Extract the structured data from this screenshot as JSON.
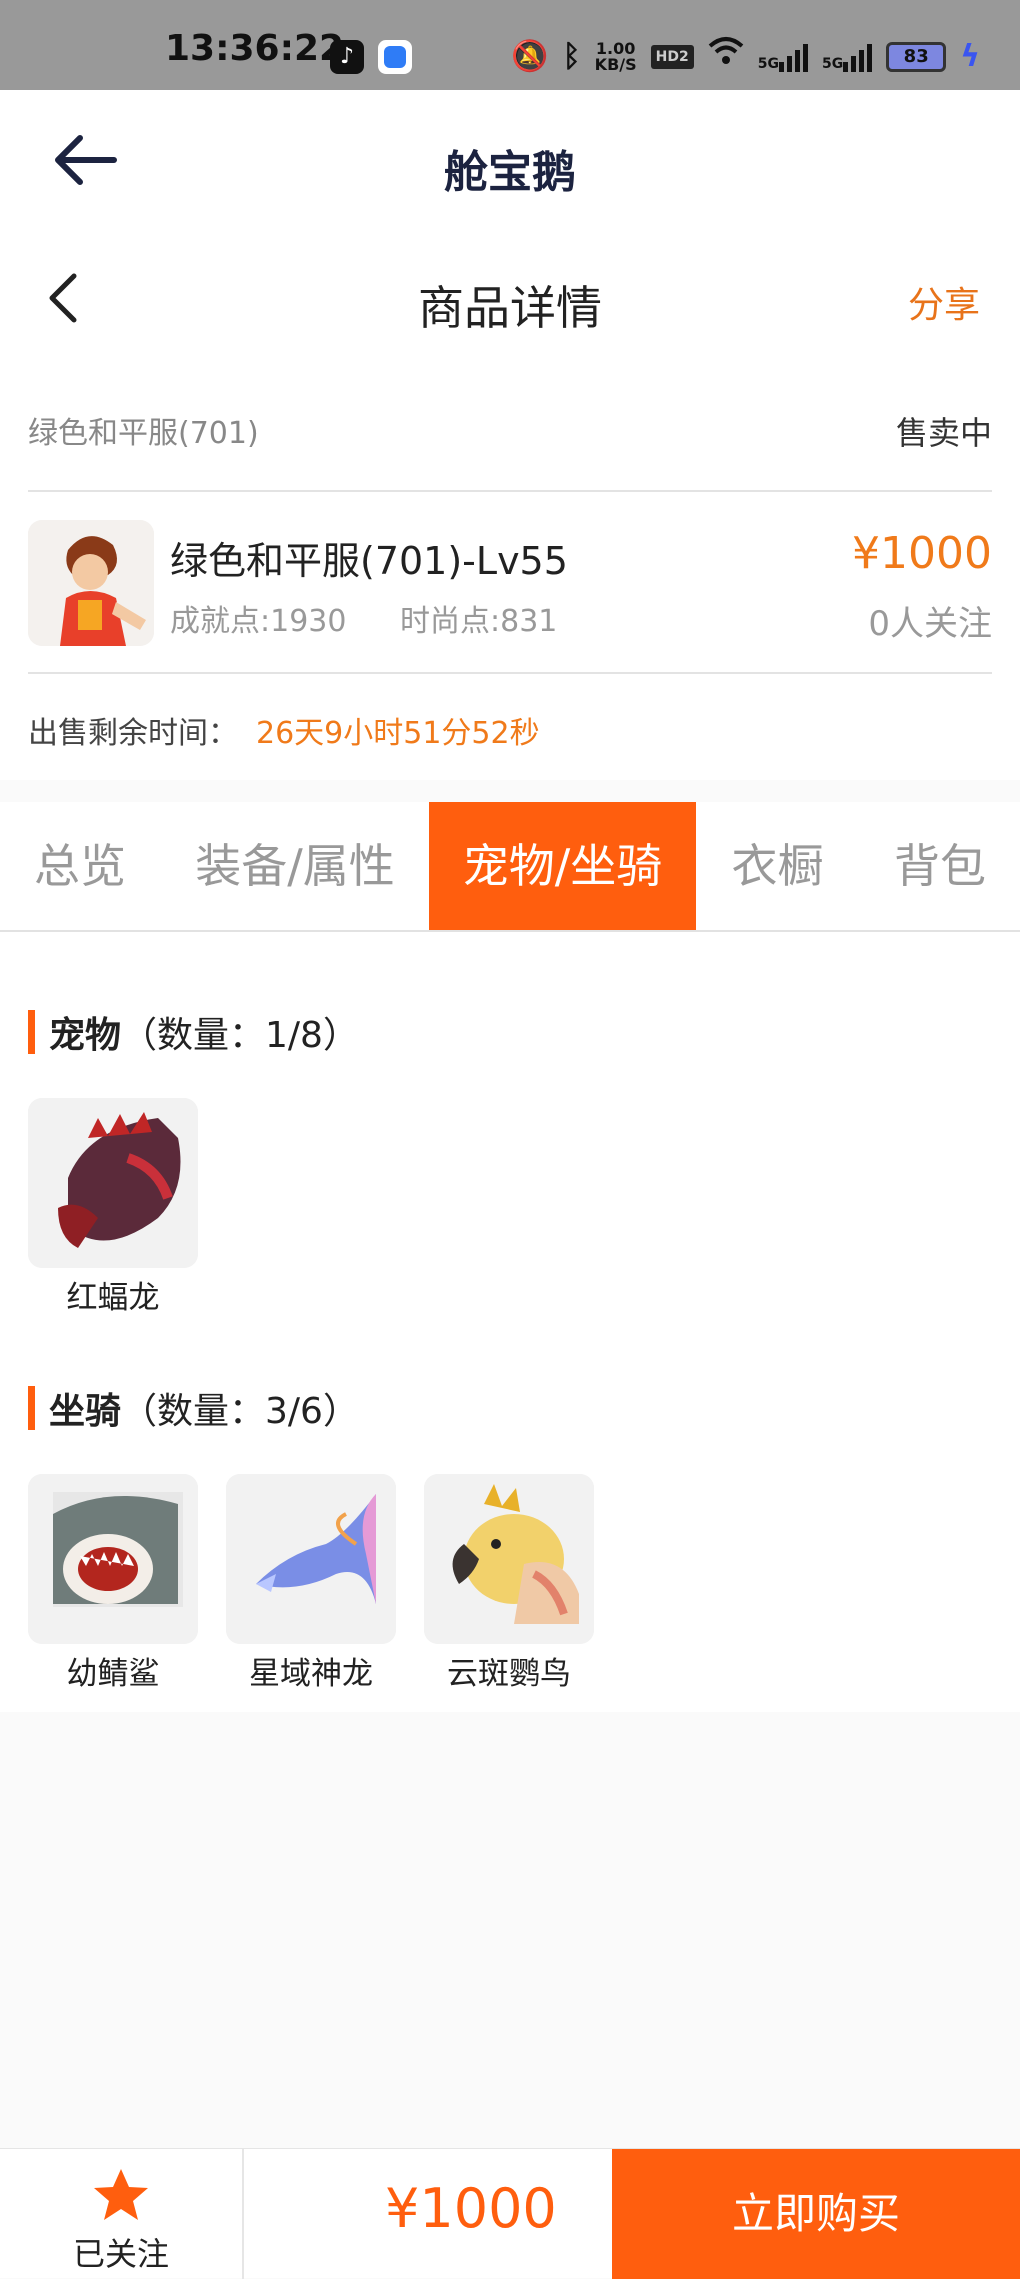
{
  "status_bar": {
    "time": "13:36:22",
    "net_speed_value": "1.00",
    "net_speed_unit": "KB/S",
    "hd": "HD2",
    "sig1": "5G",
    "sig2": "5G",
    "battery": "83"
  },
  "app_header": {
    "title": "舱宝鹅"
  },
  "sub_header": {
    "title": "商品详情",
    "share": "分享"
  },
  "product": {
    "name": "绿色和平服(701)",
    "status": "售卖中",
    "title": "绿色和平服(701)-Lv55",
    "achievement": "成就点:1930",
    "fashion": "时尚点:831",
    "price": "¥1000",
    "followers": "0人关注",
    "remaining_label": "出售剩余时间：",
    "remaining_value": "26天9小时51分52秒"
  },
  "tabs": [
    "总览",
    "装备/属性",
    "宠物/坐骑",
    "衣橱",
    "背包"
  ],
  "active_tab": "宠物/坐骑",
  "pets": {
    "title": "宠物",
    "count": "（数量：1/8）",
    "items": [
      {
        "name": "红蝠龙",
        "icon": "red-dragon-icon"
      }
    ]
  },
  "mounts": {
    "title": "坐骑",
    "count": "（数量：3/6）",
    "items": [
      {
        "name": "幼鲭鲨",
        "icon": "shark-icon"
      },
      {
        "name": "星域神龙",
        "icon": "star-dragon-icon"
      },
      {
        "name": "云斑鹦鸟",
        "icon": "parrot-icon"
      }
    ]
  },
  "bottom_bar": {
    "follow_label": "已关注",
    "price": "¥1000",
    "buy_label": "立即购买"
  },
  "colors": {
    "accent": "#ff5e0e",
    "price": "#f07a1a",
    "status_bar": "#999999"
  }
}
